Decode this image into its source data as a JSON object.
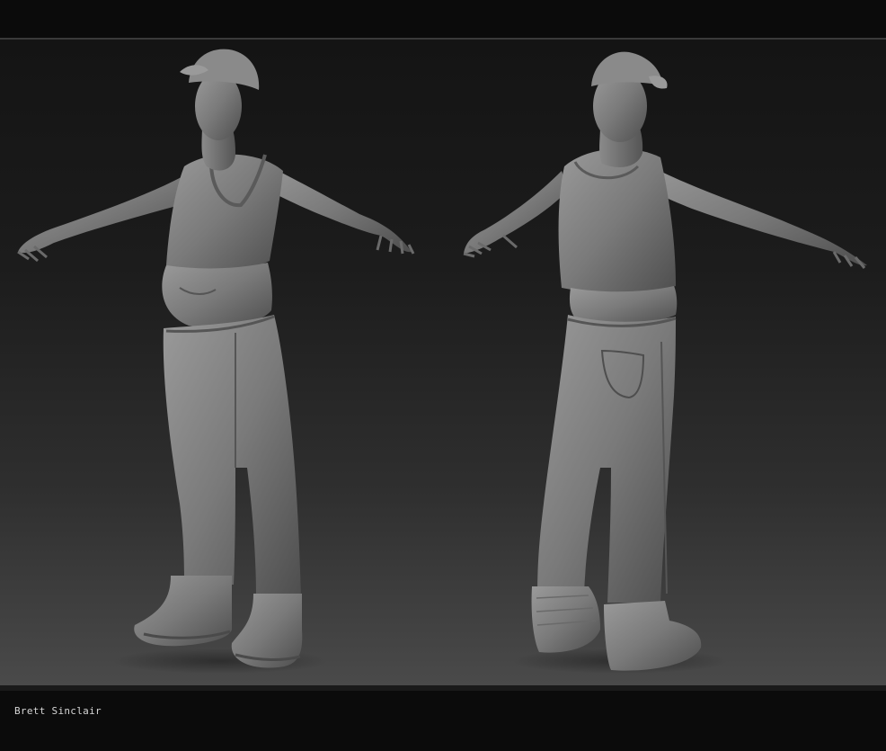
{
  "footer": {
    "credit": "Brett Sinclair"
  },
  "colors": {
    "background_top": "#141414",
    "background_bottom": "#4a4a4a",
    "model_clay": "#7a7a7a"
  }
}
